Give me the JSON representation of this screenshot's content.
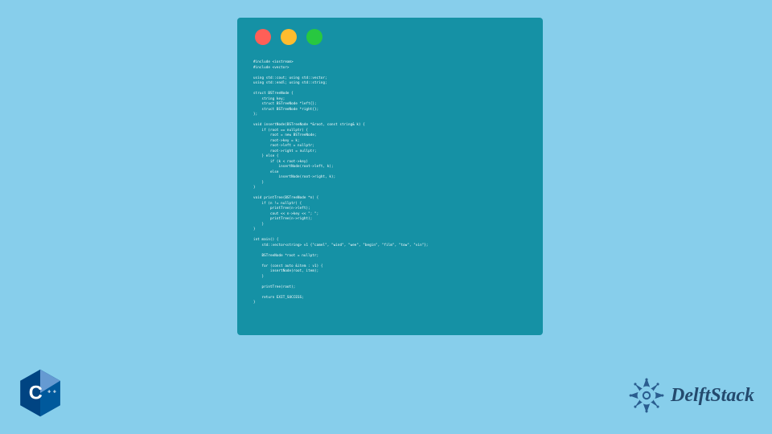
{
  "code_window": {
    "traffic_lights": [
      "red",
      "yellow",
      "green"
    ],
    "code_lines": [
      "#include <iostream>",
      "#include <vector>",
      "",
      "using std::cout; using std::vector;",
      "using std::endl; using std::string;",
      "",
      "struct BSTreeNode {",
      "    string key;",
      "    struct BSTreeNode *left{};",
      "    struct BSTreeNode *right{};",
      "};",
      "",
      "void insertNode(BSTreeNode *&root, const string& k) {",
      "    if (root == nullptr) {",
      "        root = new BSTreeNode;",
      "        root->key = k;",
      "        root->left = nullptr;",
      "        root->right = nullptr;",
      "    } else {",
      "        if (k < root->key)",
      "            insertNode(root->left, k);",
      "        else",
      "            insertNode(root->right, k);",
      "    }",
      "}",
      "",
      "void printTree(BSTreeNode *n) {",
      "    if (n != nullptr) {",
      "        printTree(n->left);",
      "        cout << n->key << \"; \";",
      "        printTree(n->right);",
      "    }",
      "}",
      "",
      "int main() {",
      "    std::vector<string> v1 {\"camel\", \"wind\", \"wee\", \"begin\", \"film\", \"tow\", \"vin\"};",
      "",
      "    BSTreeNode *root = nullptr;",
      "",
      "    for (const auto &item : v1) {",
      "        insertNode(root, item);",
      "    }",
      "",
      "    printTree(root);",
      "",
      "    return EXIT_SUCCESS;",
      "}"
    ]
  },
  "cpp_badge": {
    "label": "C++"
  },
  "brand": {
    "name": "DelftStack"
  }
}
